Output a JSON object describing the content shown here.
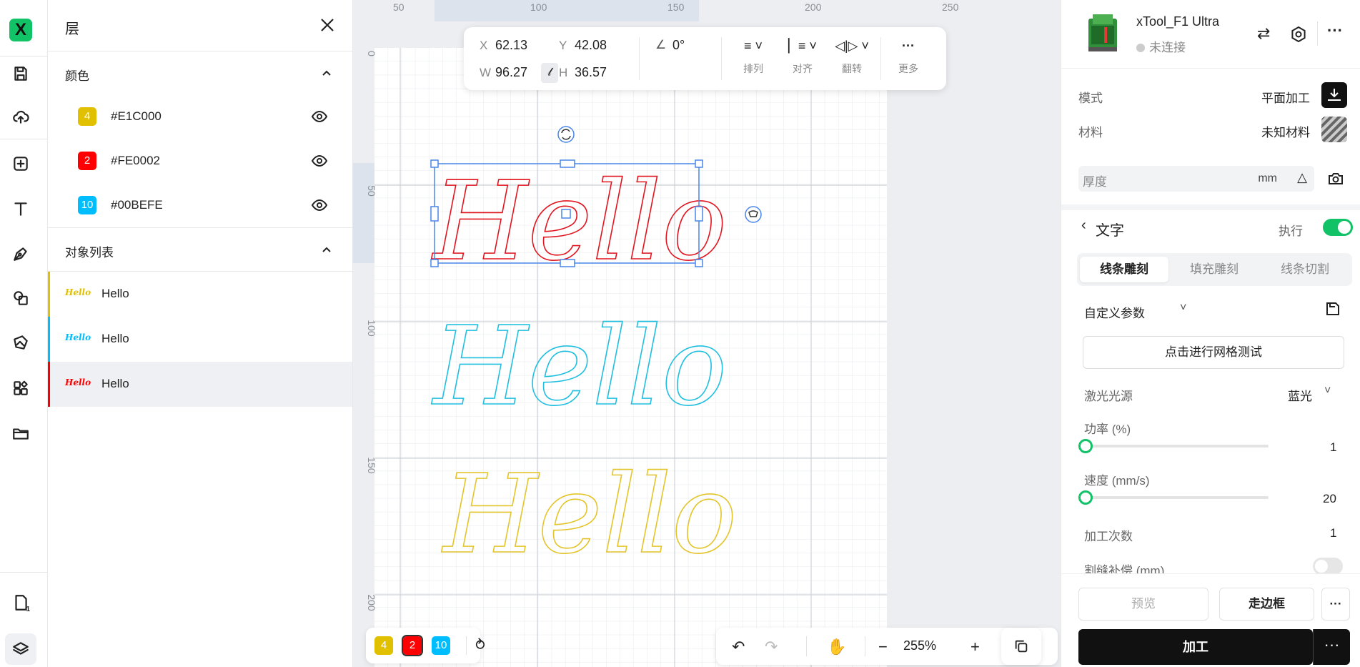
{
  "toolbar": {
    "logo": "X",
    "items": [
      "save-icon",
      "upload-icon",
      "add-icon",
      "text-icon",
      "pen-icon",
      "shapes-icon",
      "image-icon",
      "apps-icon",
      "folder-icon"
    ],
    "bottom_badge": "1"
  },
  "layers_panel": {
    "title": "层",
    "colors_section": "颜色",
    "colors": [
      {
        "num": "4",
        "hex": "#E1C000",
        "color": "#e1c000"
      },
      {
        "num": "2",
        "hex": "#FE0002",
        "color": "#fe0002"
      },
      {
        "num": "10",
        "hex": "#00BEFE",
        "color": "#00befe"
      }
    ],
    "objects_section": "对象列表",
    "objects": [
      {
        "name": "Hello",
        "color": "#e1c000",
        "thumb": "Hello"
      },
      {
        "name": "Hello",
        "color": "#00befe",
        "thumb": "Hello"
      },
      {
        "name": "Hello",
        "color": "#fe0002",
        "thumb": "Hello"
      }
    ]
  },
  "propbar": {
    "x_label": "X",
    "x": "62.13",
    "y_label": "Y",
    "y": "42.08",
    "w_label": "W",
    "w": "96.27",
    "h_label": "H",
    "h": "36.57",
    "angle": "0°",
    "arrange": "排列",
    "align": "对齐",
    "flip": "翻转",
    "more": "更多"
  },
  "ruler": {
    "top": [
      "50",
      "100",
      "150",
      "200",
      "250"
    ],
    "left": [
      "0",
      "50",
      "100",
      "150",
      "200"
    ]
  },
  "canvas": {
    "text": "Hello",
    "colors": {
      "red": "#e1151f",
      "cyan": "#1fbfe0",
      "yellow": "#e3c429",
      "selection": "#4a86e8"
    }
  },
  "bottom": {
    "chips": [
      {
        "num": "4",
        "color": "#e1c000"
      },
      {
        "num": "2",
        "color": "#fe0002"
      },
      {
        "num": "10",
        "color": "#00befe"
      }
    ],
    "zoom": "255%"
  },
  "right_panel": {
    "device_name": "xTool_F1 Ultra",
    "device_status": "未连接",
    "mode_label": "模式",
    "mode_value": "平面加工",
    "material_label": "材料",
    "material_value": "未知材料",
    "thickness_label": "厚度",
    "thickness_unit": "mm",
    "section_title": "文字",
    "execute_label": "执行",
    "tabs": [
      "线条雕刻",
      "填充雕刻",
      "线条切割"
    ],
    "params_label": "自定义参数",
    "grid_test_button": "点击进行网格测试",
    "laser_label": "激光光源",
    "laser_value": "蓝光",
    "power_label": "功率 (%)",
    "power_value": "1",
    "speed_label": "速度 (mm/s)",
    "speed_value": "20",
    "passes_label": "加工次数",
    "passes_value": "1",
    "kerf_label": "割缝补偿 (mm)",
    "preview_button": "预览",
    "frame_button": "走边框",
    "process_button": "加工"
  }
}
